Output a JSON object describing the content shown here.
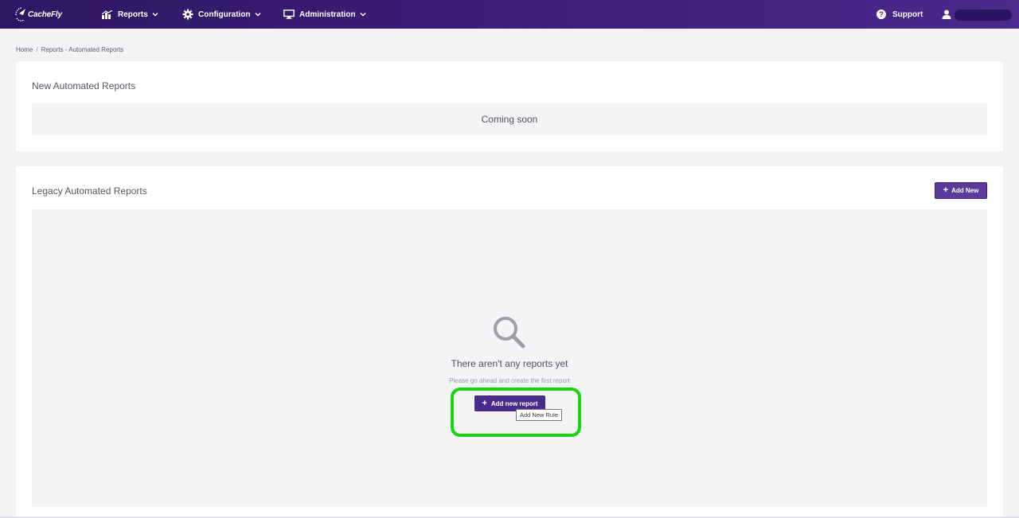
{
  "app": {
    "brand": "CacheFly"
  },
  "nav": {
    "reports": "Reports",
    "configuration": "Configuration",
    "administration": "Administration",
    "support": "Support"
  },
  "breadcrumb": {
    "home": "Home",
    "separator": "/",
    "current": "Reports - Automated Reports"
  },
  "new_reports": {
    "title": "New Automated Reports",
    "coming_soon": "Coming soon"
  },
  "legacy": {
    "title": "Legacy Automated Reports",
    "add_new_label": "Add New",
    "empty_title": "There aren't any reports yet",
    "empty_subtitle": "Please go ahead and create the first report",
    "add_report_label": "Add new report",
    "tooltip": "Add New Rule"
  },
  "colors": {
    "nav_bg": "#3a1d75",
    "primary_button": "#4a2a8a",
    "highlight": "#17d40d"
  },
  "icons": {
    "reports": "bar-chart-icon",
    "configuration": "gear-icon",
    "administration": "monitor-icon",
    "support": "question-circle-icon",
    "user": "user-icon",
    "empty": "search-icon"
  }
}
